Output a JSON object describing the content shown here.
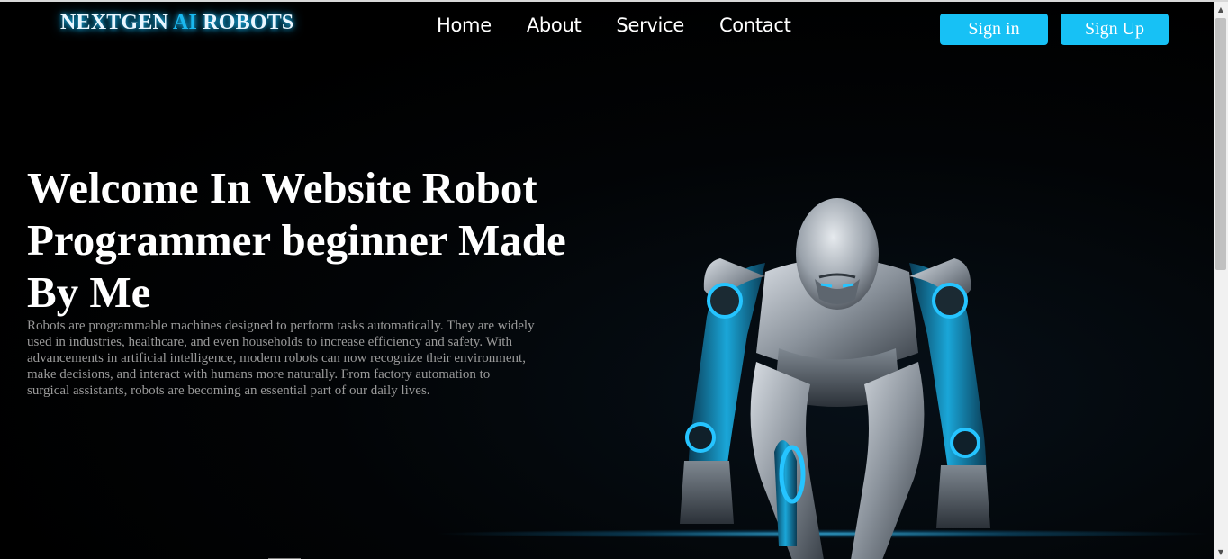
{
  "header": {
    "logo_part1": "NEXTGEN ",
    "logo_part2": "AI",
    "logo_part3": " ROBOTS",
    "nav": [
      {
        "label": "Home"
      },
      {
        "label": "About"
      },
      {
        "label": "Service"
      },
      {
        "label": "Contact"
      }
    ],
    "signin_label": "Sign in",
    "signup_label": "Sign Up"
  },
  "hero": {
    "title": "Welcome In Website Robot Programmer beginner Made By Me",
    "text": "Robots are programmable machines designed to perform tasks automatically. They are widely used in industries, healthcare, and even households to increase efficiency and safety. With advancements in artificial intelligence, modern robots can now recognize their environment, make decisions, and interact with humans more naturally. From factory automation to surgical assistants, robots are becoming an essential part of our daily lives."
  },
  "colors": {
    "accent": "#17c1f5",
    "background": "#000000",
    "body_text": "#9a9a9a"
  },
  "icons": {
    "scroll_up": "▲",
    "scroll_down": "▼"
  }
}
